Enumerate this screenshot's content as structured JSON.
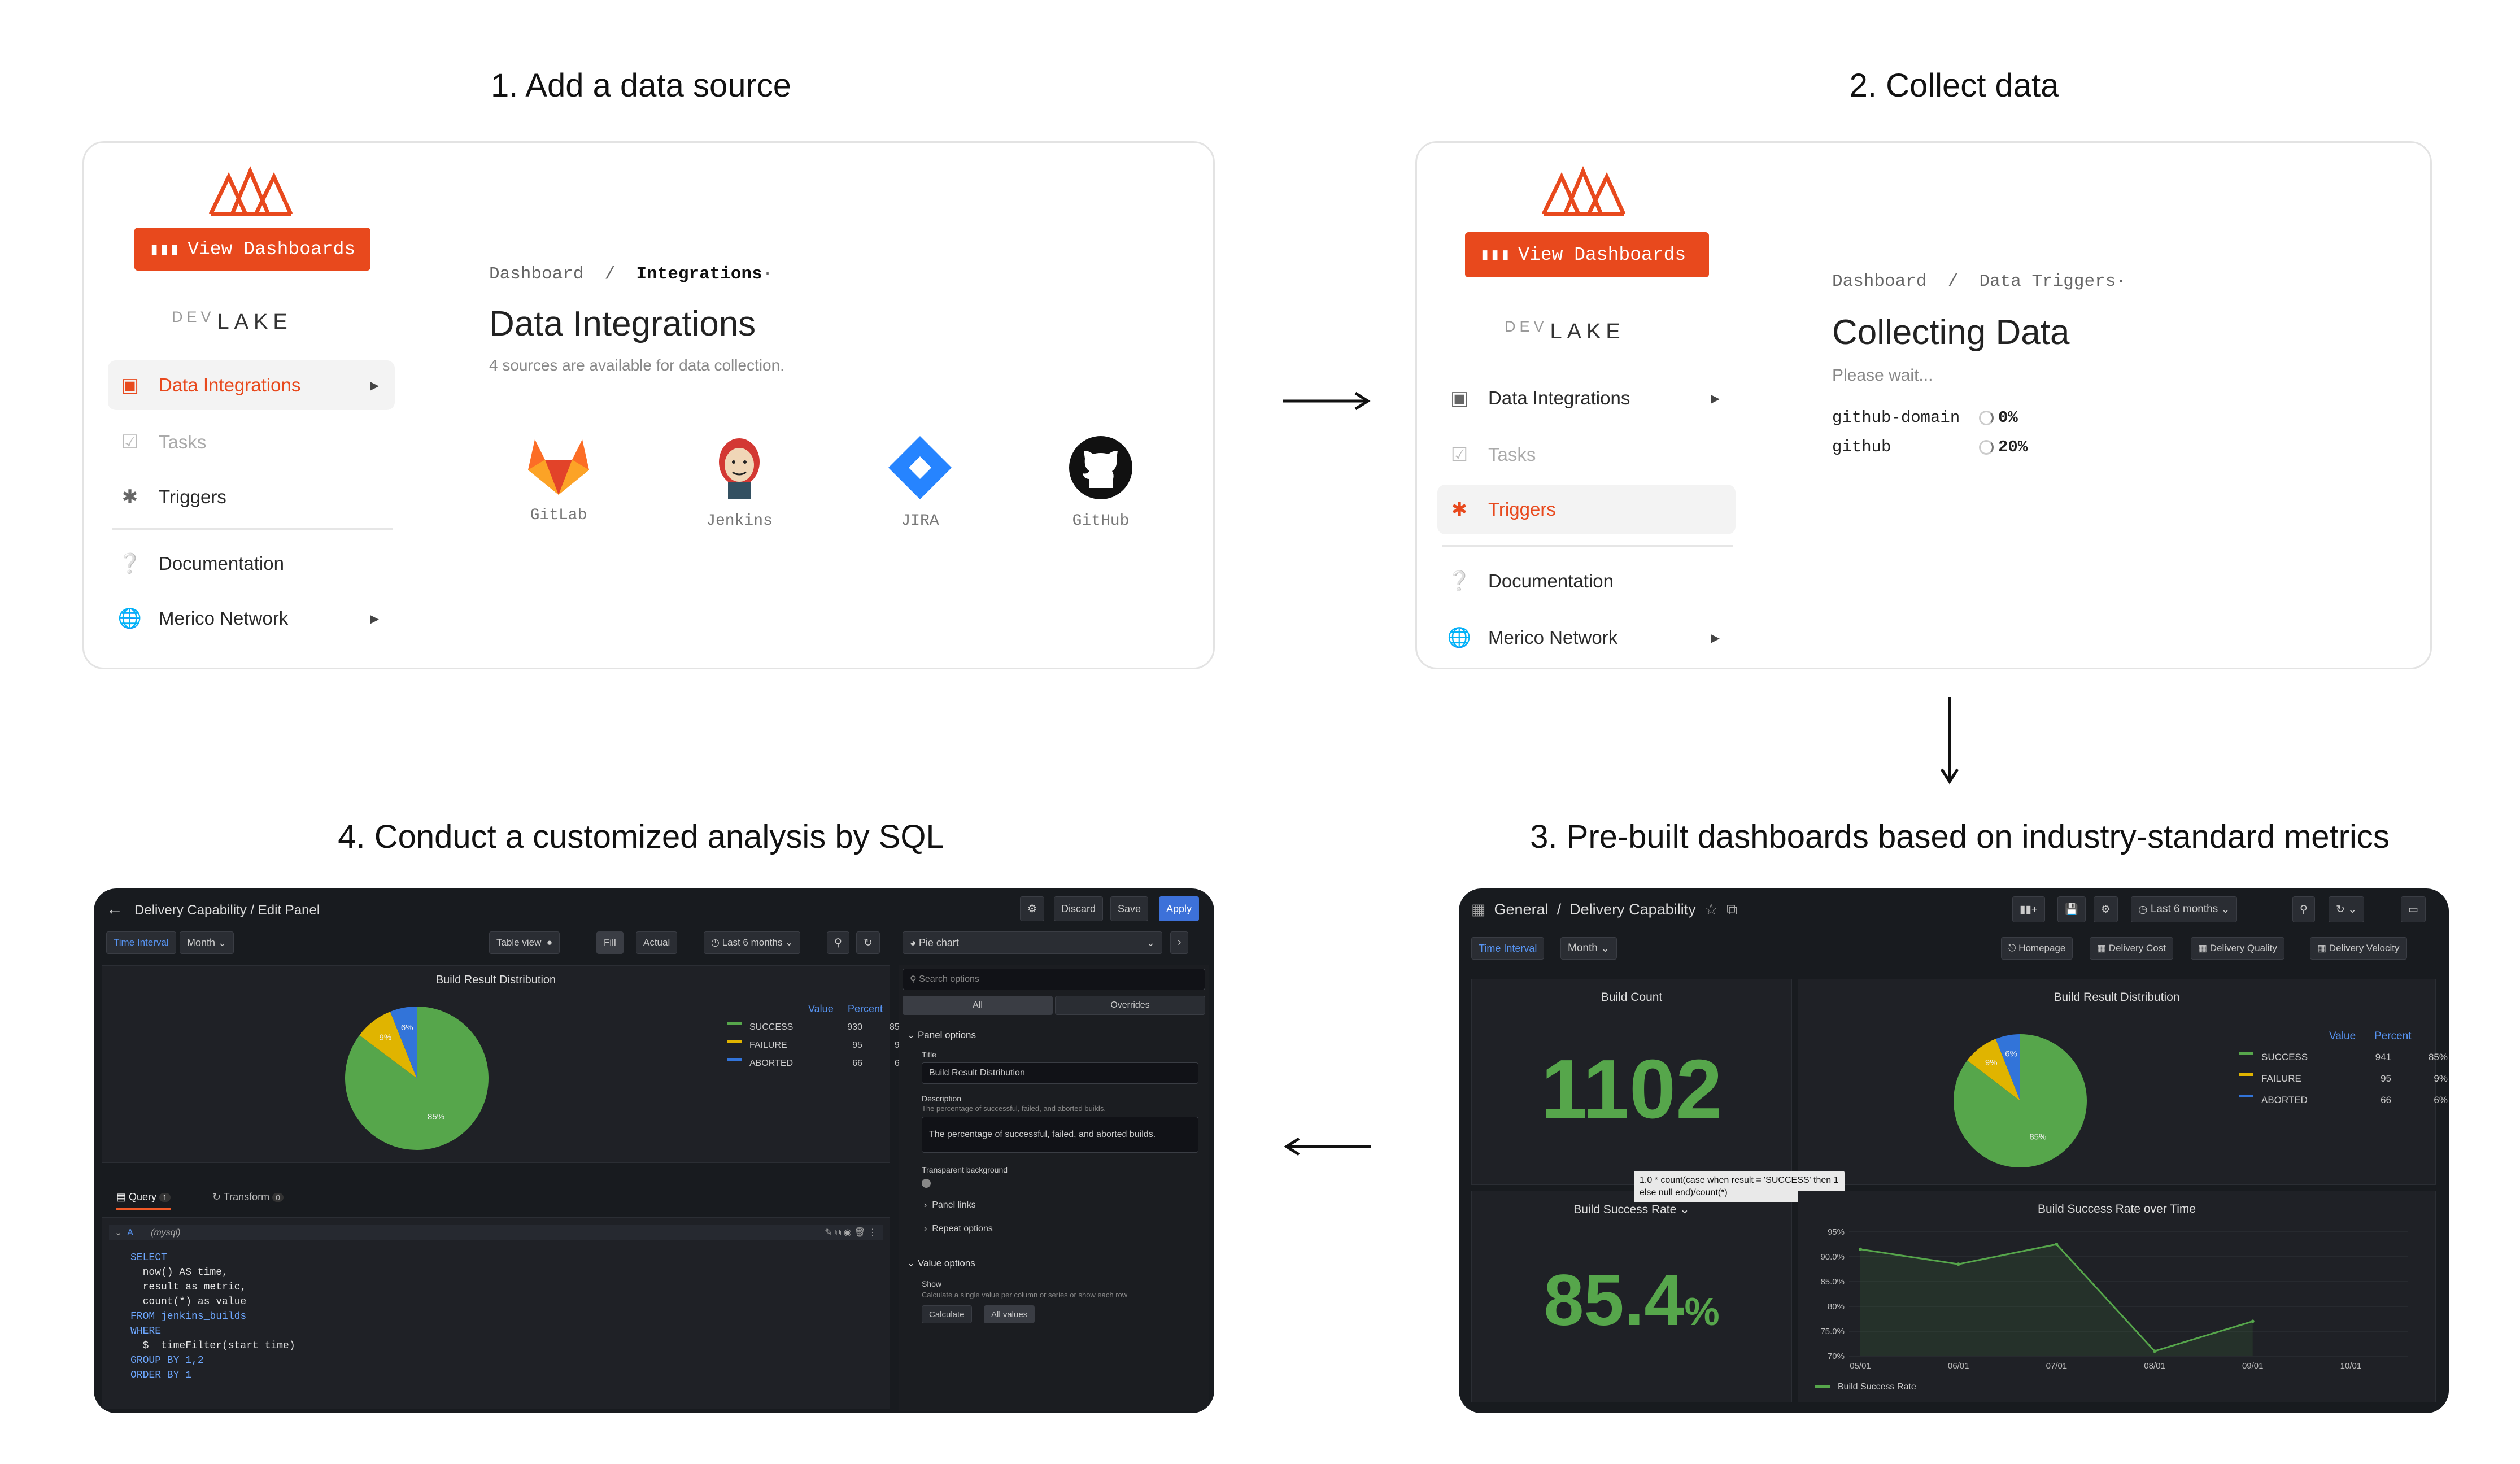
{
  "steps": {
    "s1": "1. Add a data source",
    "s2": "2. Collect data",
    "s3": "3. Pre-built dashboards based on industry-standard metrics",
    "s4": "4. Conduct a customized analysis by SQL"
  },
  "brand": {
    "accent": "#e8491d",
    "dev": "DEV",
    "lake": "LAKE",
    "view_dashboards": "View Dashboards"
  },
  "sidebar": {
    "data_integrations": "Data Integrations",
    "tasks": "Tasks",
    "triggers": "Triggers",
    "documentation": "Documentation",
    "merico_network": "Merico Network"
  },
  "panel1": {
    "crumb_root": "Dashboard",
    "crumb_current": "Integrations",
    "title": "Data Integrations",
    "subtitle": "4 sources are available for data collection.",
    "sources": [
      "GitLab",
      "Jenkins",
      "JIRA",
      "GitHub"
    ]
  },
  "panel2": {
    "crumb_root": "Dashboard",
    "crumb_current": "Data Triggers",
    "title": "Collecting Data",
    "subtitle": "Please wait...",
    "jobs": [
      {
        "name": "github-domain",
        "progress": "0%"
      },
      {
        "name": "github",
        "progress": "20%"
      }
    ]
  },
  "panel3": {
    "breadcrumb_root": "General",
    "breadcrumb_current": "Delivery Capability",
    "time_range": "Last 6 months",
    "time_interval_label": "Time Interval",
    "time_interval_value": "Month",
    "links": [
      "Homepage",
      "Delivery Cost",
      "Delivery Quality",
      "Delivery Velocity"
    ],
    "build_count_title": "Build Count",
    "build_count": "1102",
    "brd_title": "Build Result Distribution",
    "value_hdr": "Value",
    "percent_hdr": "Percent",
    "legend": [
      {
        "name": "SUCCESS",
        "value": "941",
        "percent": "85%",
        "color": "#56a64b"
      },
      {
        "name": "FAILURE",
        "value": "95",
        "percent": "9%",
        "color": "#e0b400"
      },
      {
        "name": "ABORTED",
        "value": "66",
        "percent": "6%",
        "color": "#3274d9"
      }
    ],
    "pie_labels": [
      "85%",
      "9%",
      "6%"
    ],
    "rate_title": "Build Success Rate",
    "rate_value": "85.4",
    "rate_unit": "%",
    "tooltip_l1": "1.0 * count(case when result = 'SUCCESS' then 1",
    "tooltip_l2": "else null end)/count(*)",
    "rot_title": "Build Success Rate over Time",
    "rot_series": "Build Success Rate"
  },
  "chart_data": {
    "type": "line",
    "title": "Build Success Rate over Time",
    "x": [
      "05/01",
      "06/01",
      "07/01",
      "08/01",
      "09/01",
      "10/01"
    ],
    "series": [
      {
        "name": "Build Success Rate",
        "values": [
          91.5,
          88.5,
          92.5,
          71,
          77,
          null
        ]
      }
    ],
    "y_ticks": [
      "95%",
      "90.0%",
      "85.0%",
      "80%",
      "75.0%",
      "70%"
    ],
    "ylim": [
      70,
      95
    ]
  },
  "panel4": {
    "header": "Delivery Capability / Edit Panel",
    "discard": "Discard",
    "save": "Save",
    "apply": "Apply",
    "time_interval_label": "Time Interval",
    "time_interval_value": "Month",
    "table_view": "Table view",
    "fill": "Fill",
    "actual": "Actual",
    "time_range": "Last 6 months",
    "viz": "Pie chart",
    "chart_title": "Build Result Distribution",
    "value_hdr": "Value",
    "percent_hdr": "Percent",
    "legend": [
      {
        "name": "SUCCESS",
        "value": "930",
        "percent": "85%"
      },
      {
        "name": "FAILURE",
        "value": "95",
        "percent": "9%"
      },
      {
        "name": "ABORTED",
        "value": "66",
        "percent": "6%"
      }
    ],
    "pie_labels": [
      "85%",
      "9%",
      "6%"
    ],
    "query_tab": "Query",
    "query_count": "1",
    "transform_tab": "Transform",
    "transform_count": "0",
    "query_name": "A",
    "query_ds": "(mysql)",
    "sql": [
      "SELECT",
      "  now() AS time,",
      "  result as metric,",
      "  count(*) as value",
      "FROM jenkins_builds",
      "WHERE",
      "  $__timeFilter(start_time)",
      "GROUP BY 1,2",
      "ORDER BY 1"
    ],
    "search_options": "Search options",
    "all": "All",
    "overrides": "Overrides",
    "panel_options": "Panel options",
    "title_label": "Title",
    "title_value": "Build Result Distribution",
    "desc_label": "Description",
    "desc_hint": "The percentage of successful, failed, and aborted builds.",
    "desc_value": "The percentage of successful, failed, and aborted builds.",
    "transparent": "Transparent background",
    "panel_links": "Panel links",
    "repeat_options": "Repeat options",
    "value_options": "Value options",
    "show": "Show",
    "show_hint": "Calculate a single value per column or series or show each row",
    "calculate": "Calculate",
    "all_values": "All values"
  }
}
